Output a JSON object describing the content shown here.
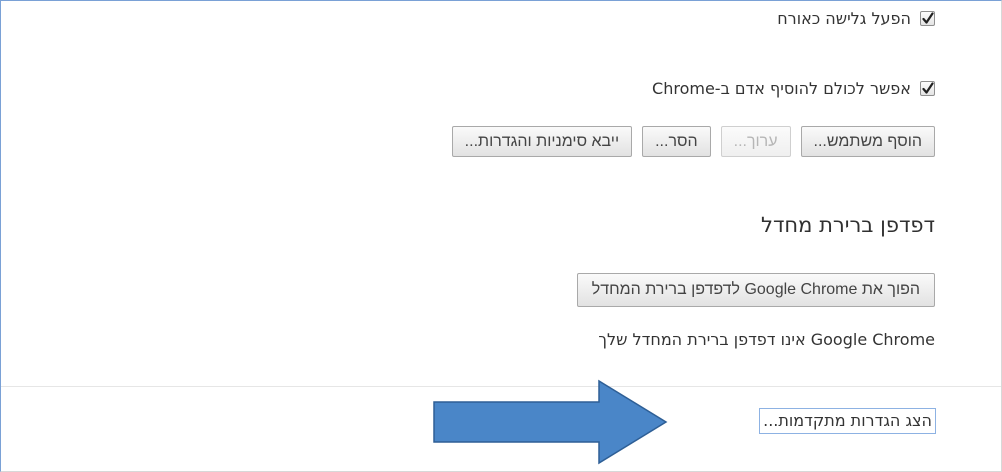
{
  "people": {
    "guest_browsing_label": "הפעל גלישה כאורח",
    "guest_browsing_checked": true,
    "allow_add_person_label": "אפשר לכולם להוסיף אדם ב-Chrome",
    "allow_add_person_checked": true,
    "buttons": {
      "add_user": "הוסף משתמש...",
      "edit": "ערוך...",
      "remove": "הסר...",
      "import": "ייבא סימניות והגדרות..."
    }
  },
  "default_browser": {
    "heading": "דפדפן ברירת מחדל",
    "make_default_button": "הפוך את Google Chrome לדפדפן ברירת המחדל",
    "status_text": "Google Chrome אינו דפדפן ברירת המחדל שלך"
  },
  "advanced": {
    "show_advanced_link": "הצג הגדרות מתקדמות..."
  },
  "annotation": {
    "arrow_icon": "right-arrow-icon",
    "arrow_color": "#4a86c8",
    "arrow_border_color": "#2e5f96"
  },
  "colors": {
    "frame_border": "#7aa1d6",
    "focus_ring": "#8db2e3",
    "text": "#333333"
  }
}
